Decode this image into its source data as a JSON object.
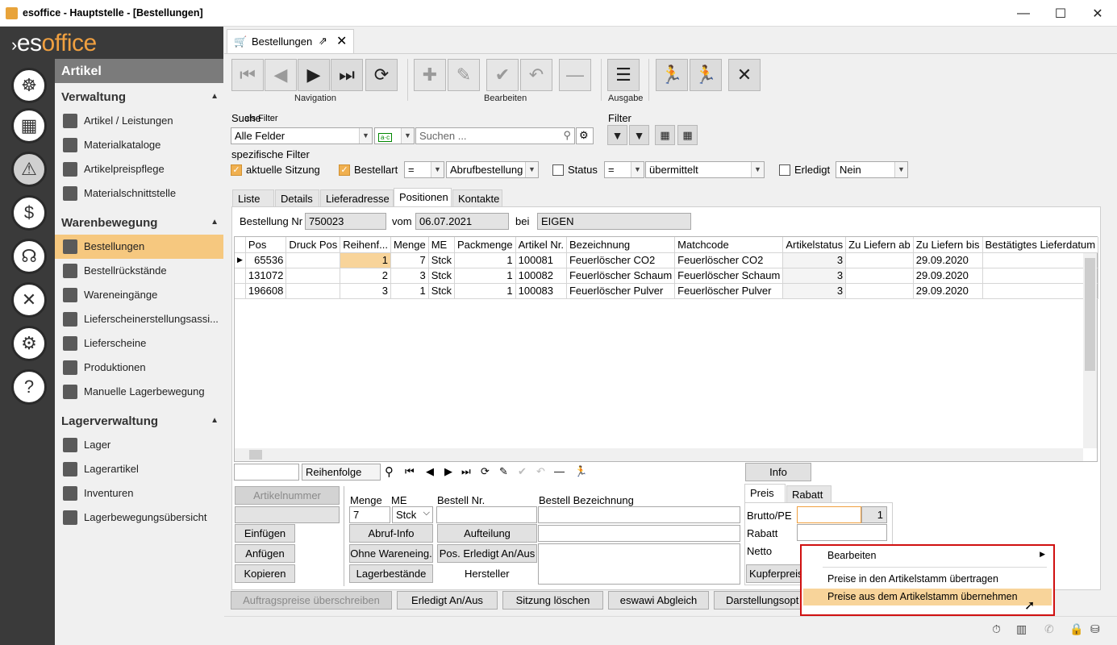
{
  "window": {
    "title": "esoffice - Hauptstelle - [Bestellungen]"
  },
  "logo": {
    "text_a": "es",
    "text_b": "office"
  },
  "sidebar": {
    "header": "Artikel",
    "groups": [
      {
        "label": "Verwaltung",
        "items": [
          "Artikel / Leistungen",
          "Materialkataloge",
          "Artikelpreispflege",
          "Materialschnittstelle"
        ]
      },
      {
        "label": "Warenbewegung",
        "items": [
          "Bestellungen",
          "Bestellrückstände",
          "Wareneingänge",
          "Lieferscheinerstellungsassi...",
          "Lieferscheine",
          "Produktionen",
          "Manuelle Lagerbewegung"
        ]
      },
      {
        "label": "Lagerverwaltung",
        "items": [
          "Lager",
          "Lagerartikel",
          "Inventuren",
          "Lagerbewegungsübersicht"
        ]
      }
    ],
    "selected": "Bestellungen"
  },
  "tab": {
    "label": "Bestellungen"
  },
  "toolbar": {
    "navigation_label": "Navigation",
    "bearbeiten_label": "Bearbeiten",
    "ausgabe_label": "Ausgabe"
  },
  "search": {
    "label": "Suche",
    "as_filter": "als Filter",
    "field": "Alle Felder",
    "placeholder": "Suchen ...",
    "filter_label": "Filter",
    "specific_label": "spezifische Filter"
  },
  "filters": {
    "aktuelle_sitzung": "aktuelle Sitzung",
    "bestellart": "Bestellart",
    "bestellart_op": "=",
    "bestellart_val": "Abrufbestellung",
    "status": "Status",
    "status_op": "=",
    "status_val": "übermittelt",
    "erledigt": "Erledigt",
    "erledigt_val": "Nein"
  },
  "subtabs": [
    "Liste",
    "Details",
    "Lieferadresse",
    "Positionen",
    "Kontakte"
  ],
  "order": {
    "nr_label": "Bestellung Nr",
    "nr": "750023",
    "vom_label": "vom",
    "vom": "06.07.2021",
    "bei_label": "bei",
    "bei": "EIGEN"
  },
  "grid": {
    "columns": [
      "Pos",
      "Druck Pos",
      "Reihenf...",
      "Menge",
      "ME",
      "Packmenge",
      "Artikel Nr.",
      "Bezeichnung",
      "Matchcode",
      "Artikelstatus",
      "Zu Liefern ab",
      "Zu Liefern bis",
      "Bestätigtes Lieferdatum"
    ],
    "rows": [
      [
        "65536",
        "",
        "1",
        "7",
        "Stck",
        "1",
        "100081",
        "Feuerlöscher CO2",
        "Feuerlöscher CO2",
        "3",
        "",
        "29.09.2020",
        ""
      ],
      [
        "131072",
        "",
        "2",
        "3",
        "Stck",
        "1",
        "100082",
        "Feuerlöscher Schaum",
        "Feuerlöscher Schaum",
        "3",
        "",
        "29.09.2020",
        ""
      ],
      [
        "196608",
        "",
        "3",
        "1",
        "Stck",
        "1",
        "100083",
        "Feuerlöscher Pulver",
        "Feuerlöscher Pulver",
        "3",
        "",
        "29.09.2020",
        ""
      ]
    ]
  },
  "gridnav": {
    "sort_field": "Reihenfolge",
    "info": "Info"
  },
  "entry": {
    "artikelnummer": "Artikelnummer",
    "einfuegen": "Einfügen",
    "anfuegen": "Anfügen",
    "kopieren": "Kopieren",
    "menge_label": "Menge",
    "menge": "7",
    "me_label": "ME",
    "me": "Stck",
    "bestellnr_label": "Bestell Nr.",
    "bestellbez_label": "Bestell Bezeichnung",
    "abruf_info": "Abruf-Info",
    "aufteilung": "Aufteilung",
    "ohne_wareneing": "Ohne Wareneing.",
    "pos_erledigt": "Pos. Erledigt An/Aus",
    "lagerbestaende": "Lagerbestände",
    "hersteller": "Hersteller"
  },
  "price": {
    "tab_preis": "Preis",
    "tab_rabatt": "Rabatt",
    "brutto": "Brutto/PE",
    "pe": "1",
    "rabatt": "Rabatt",
    "netto": "Netto",
    "kupfer": "Kupferpreis"
  },
  "bottom": {
    "auftragspreise": "Auftragspreise überschreiben",
    "erledigt": "Erledigt An/Aus",
    "sitzung": "Sitzung löschen",
    "eswawi": "eswawi Abgleich",
    "darstellung": "Darstellungsopt"
  },
  "context_menu": {
    "items": [
      "Bearbeiten",
      "Preise in den Artikelstamm übertragen",
      "Preise aus dem Artikelstamm übernehmen"
    ],
    "highlighted": "Preise aus dem Artikelstamm übernehmen"
  }
}
